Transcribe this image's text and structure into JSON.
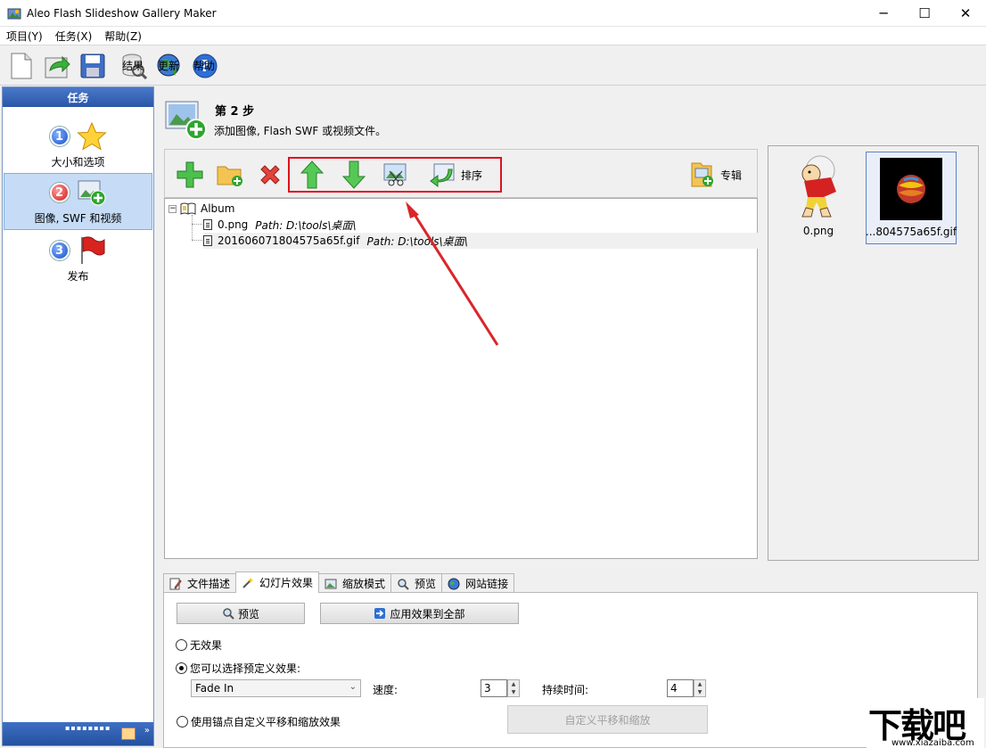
{
  "window": {
    "title": "Aleo Flash Slideshow Gallery Maker",
    "minimize": "─",
    "maximize": "☐",
    "close": "✕"
  },
  "menu": {
    "project": "项目(Y)",
    "task": "任务(X)",
    "help": "帮助(Z)"
  },
  "toolbar": {
    "results": "结果",
    "update": "更新",
    "help": "帮助"
  },
  "tasks": {
    "header": "任务",
    "items": [
      {
        "num": "1",
        "label": "大小和选项"
      },
      {
        "num": "2",
        "label": "图像, SWF 和视频"
      },
      {
        "num": "3",
        "label": "发布"
      }
    ],
    "grip": "▪▪▪▪▪▪▪▪",
    "more": "»"
  },
  "step": {
    "title": "第 2 步",
    "desc": "添加图像, Flash SWF 或视频文件。"
  },
  "album_toolbar": {
    "sort": "排序",
    "album": "专辑"
  },
  "tree": {
    "root": "Album",
    "expander": "−",
    "items": [
      {
        "name": "0.png",
        "path": "Path: D:\\tools\\桌面\\"
      },
      {
        "name": "201606071804575a65f.gif",
        "path": "Path: D:\\tools\\桌面\\"
      }
    ]
  },
  "thumbs": [
    {
      "name": "0.png"
    },
    {
      "name": "...804575a65f.gif"
    }
  ],
  "tabs": [
    "文件描述",
    "幻灯片效果",
    "缩放模式",
    "预览",
    "网站链接"
  ],
  "effects": {
    "preview_btn": "预览",
    "apply_all_btn": "应用效果到全部",
    "no_effect": "无效果",
    "preset_effect": "您可以选择预定义效果:",
    "preset_value": "Fade In",
    "speed_label": "速度:",
    "speed_value": "3",
    "duration_label": "持续时间:",
    "duration_value": "4",
    "custom_pan": "使用锚点自定义平移和缩放效果",
    "custom_pan_btn": "自定义平移和缩放"
  },
  "watermark": {
    "big": "下载吧",
    "small": "www.xiazaiba.com"
  },
  "colors": {
    "highlight": "#e0101e",
    "panel_blue": "#2a56a8"
  }
}
